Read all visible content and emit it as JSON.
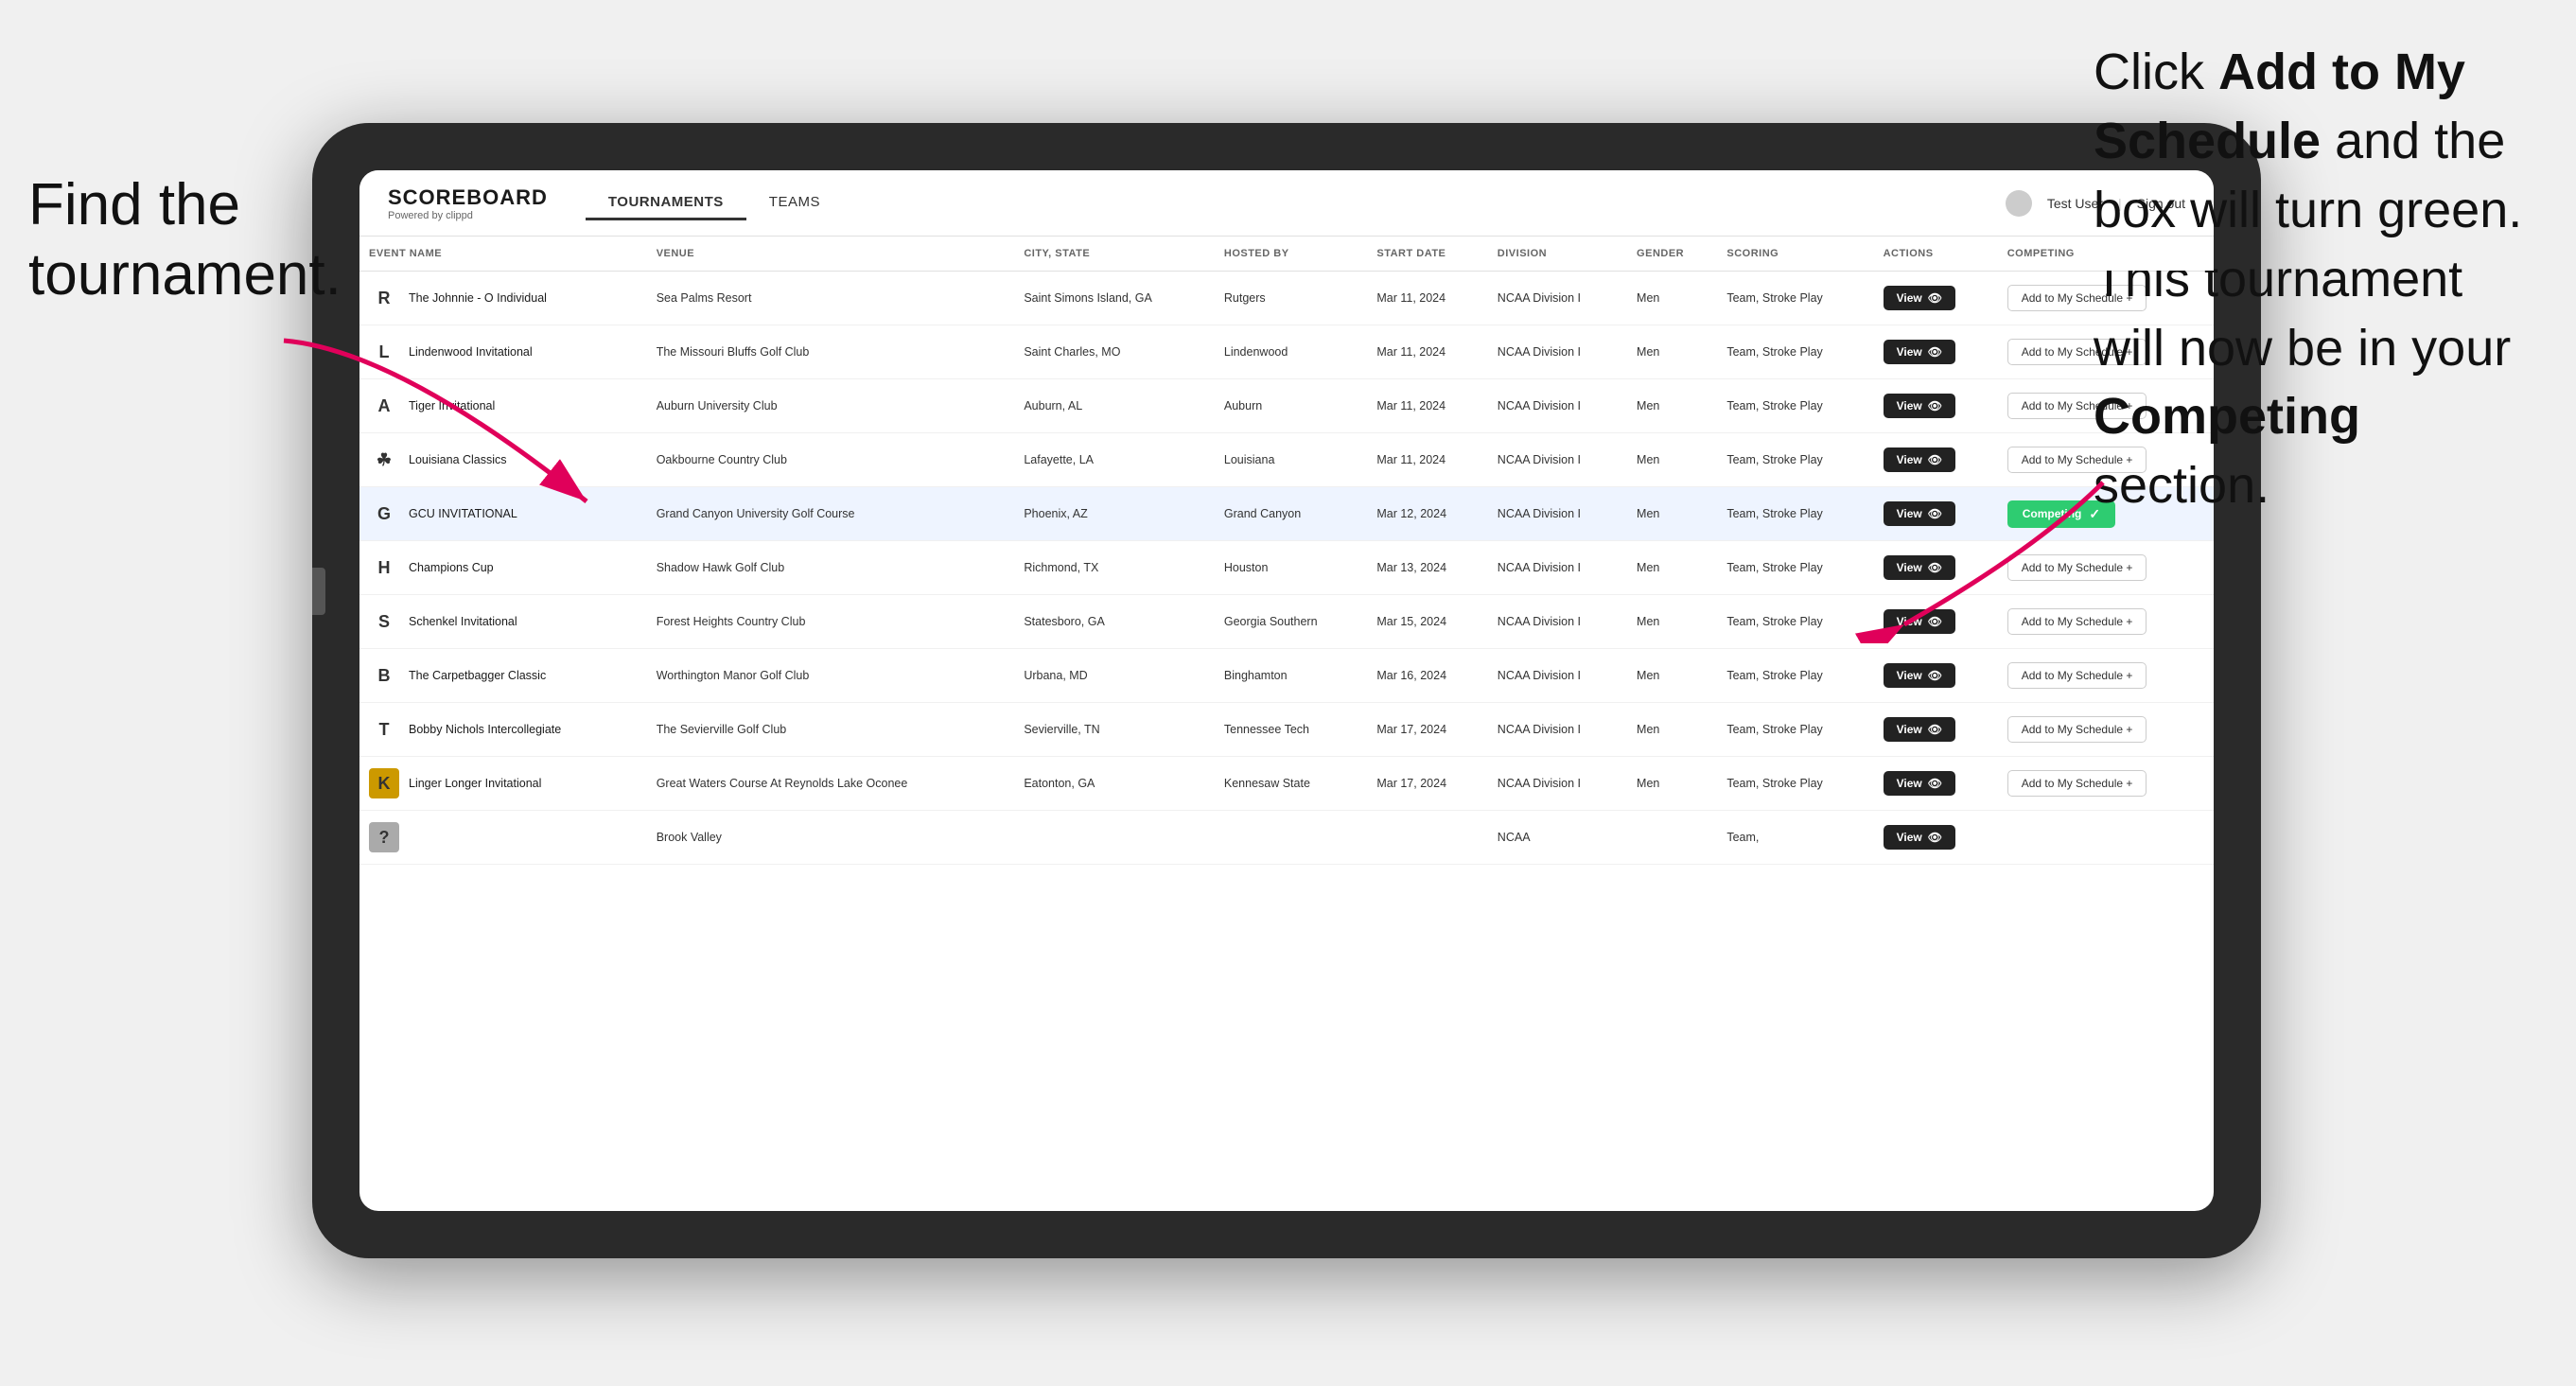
{
  "annotations": {
    "left": "Find the\ntournament.",
    "right_line1": "Click ",
    "right_bold1": "Add to My\nSchedule",
    "right_line2": " and the\nbox will turn green.\nThis tournament\nwill now be in\nyour ",
    "right_bold2": "Competing",
    "right_line3": " section."
  },
  "navbar": {
    "logo": "SCOREBOARD",
    "logo_sub": "Powered by clippd",
    "tabs": [
      "TOURNAMENTS",
      "TEAMS"
    ],
    "active_tab": "TOURNAMENTS",
    "user": "Test User",
    "sign_out": "Sign out"
  },
  "table": {
    "columns": [
      "EVENT NAME",
      "VENUE",
      "CITY, STATE",
      "HOSTED BY",
      "START DATE",
      "DIVISION",
      "GENDER",
      "SCORING",
      "ACTIONS",
      "COMPETING"
    ],
    "rows": [
      {
        "id": 1,
        "logo_color": "#cc0000",
        "logo_char": "R",
        "event": "The Johnnie - O Individual",
        "venue": "Sea Palms Resort",
        "city_state": "Saint Simons Island, GA",
        "hosted_by": "Rutgers",
        "start_date": "Mar 11, 2024",
        "division": "NCAA Division I",
        "gender": "Men",
        "scoring": "Team, Stroke Play",
        "action": "View",
        "competing": "Add to My Schedule +",
        "competing_type": "add",
        "highlighted": false
      },
      {
        "id": 2,
        "logo_color": "#c8102e",
        "logo_char": "L",
        "event": "Lindenwood Invitational",
        "venue": "The Missouri Bluffs Golf Club",
        "city_state": "Saint Charles, MO",
        "hosted_by": "Lindenwood",
        "start_date": "Mar 11, 2024",
        "division": "NCAA Division I",
        "gender": "Men",
        "scoring": "Team, Stroke Play",
        "action": "View",
        "competing": "Add to My Schedule +",
        "competing_type": "add",
        "highlighted": false
      },
      {
        "id": 3,
        "logo_color": "#0c2340",
        "logo_char": "A",
        "event": "Tiger Invitational",
        "venue": "Auburn University Club",
        "city_state": "Auburn, AL",
        "hosted_by": "Auburn",
        "start_date": "Mar 11, 2024",
        "division": "NCAA Division I",
        "gender": "Men",
        "scoring": "Team, Stroke Play",
        "action": "View",
        "competing": "Add to My Schedule +",
        "competing_type": "add",
        "highlighted": false
      },
      {
        "id": 4,
        "logo_color": "#8b0000",
        "logo_char": "☘",
        "event": "Louisiana Classics",
        "venue": "Oakbourne Country Club",
        "city_state": "Lafayette, LA",
        "hosted_by": "Louisiana",
        "start_date": "Mar 11, 2024",
        "division": "NCAA Division I",
        "gender": "Men",
        "scoring": "Team, Stroke Play",
        "action": "View",
        "competing": "Add to My Schedule +",
        "competing_type": "add",
        "highlighted": false
      },
      {
        "id": 5,
        "logo_color": "#522398",
        "logo_char": "G",
        "event": "GCU INVITATIONAL",
        "venue": "Grand Canyon University Golf Course",
        "city_state": "Phoenix, AZ",
        "hosted_by": "Grand Canyon",
        "start_date": "Mar 12, 2024",
        "division": "NCAA Division I",
        "gender": "Men",
        "scoring": "Team, Stroke Play",
        "action": "View",
        "competing": "Competing ✓",
        "competing_type": "competing",
        "highlighted": true
      },
      {
        "id": 6,
        "logo_color": "#cc0000",
        "logo_char": "H",
        "event": "Champions Cup",
        "venue": "Shadow Hawk Golf Club",
        "city_state": "Richmond, TX",
        "hosted_by": "Houston",
        "start_date": "Mar 13, 2024",
        "division": "NCAA Division I",
        "gender": "Men",
        "scoring": "Team, Stroke Play",
        "action": "View",
        "competing": "Add to My Schedule +",
        "competing_type": "add",
        "highlighted": false
      },
      {
        "id": 7,
        "logo_color": "#003366",
        "logo_char": "S",
        "event": "Schenkel Invitational",
        "venue": "Forest Heights Country Club",
        "city_state": "Statesboro, GA",
        "hosted_by": "Georgia Southern",
        "start_date": "Mar 15, 2024",
        "division": "NCAA Division I",
        "gender": "Men",
        "scoring": "Team, Stroke Play",
        "action": "View",
        "competing": "Add to My Schedule +",
        "competing_type": "add",
        "highlighted": false
      },
      {
        "id": 8,
        "logo_color": "#005030",
        "logo_char": "B",
        "event": "The Carpetbagger Classic",
        "venue": "Worthington Manor Golf Club",
        "city_state": "Urbana, MD",
        "hosted_by": "Binghamton",
        "start_date": "Mar 16, 2024",
        "division": "NCAA Division I",
        "gender": "Men",
        "scoring": "Team, Stroke Play",
        "action": "View",
        "competing": "Add to My Schedule +",
        "competing_type": "add",
        "highlighted": false
      },
      {
        "id": 9,
        "logo_color": "#003087",
        "logo_char": "T",
        "event": "Bobby Nichols Intercollegiate",
        "venue": "The Sevierville Golf Club",
        "city_state": "Sevierville, TN",
        "hosted_by": "Tennessee Tech",
        "start_date": "Mar 17, 2024",
        "division": "NCAA Division I",
        "gender": "Men",
        "scoring": "Team, Stroke Play",
        "action": "View",
        "competing": "Add to My Schedule +",
        "competing_type": "add",
        "highlighted": false
      },
      {
        "id": 10,
        "logo_color": "#ffcc00",
        "logo_char": "K",
        "event": "Linger Longer Invitational",
        "venue": "Great Waters Course At Reynolds Lake Oconee",
        "city_state": "Eatonton, GA",
        "hosted_by": "Kennesaw State",
        "start_date": "Mar 17, 2024",
        "division": "NCAA Division I",
        "gender": "Men",
        "scoring": "Team, Stroke Play",
        "action": "View",
        "competing": "Add to My Schedule +",
        "competing_type": "add",
        "highlighted": false
      },
      {
        "id": 11,
        "logo_color": "#666",
        "logo_char": "?",
        "event": "",
        "venue": "Brook Valley",
        "city_state": "",
        "hosted_by": "",
        "start_date": "",
        "division": "NCAA",
        "gender": "",
        "scoring": "Team,",
        "action": "View",
        "competing": "",
        "competing_type": "add",
        "highlighted": false
      }
    ]
  }
}
